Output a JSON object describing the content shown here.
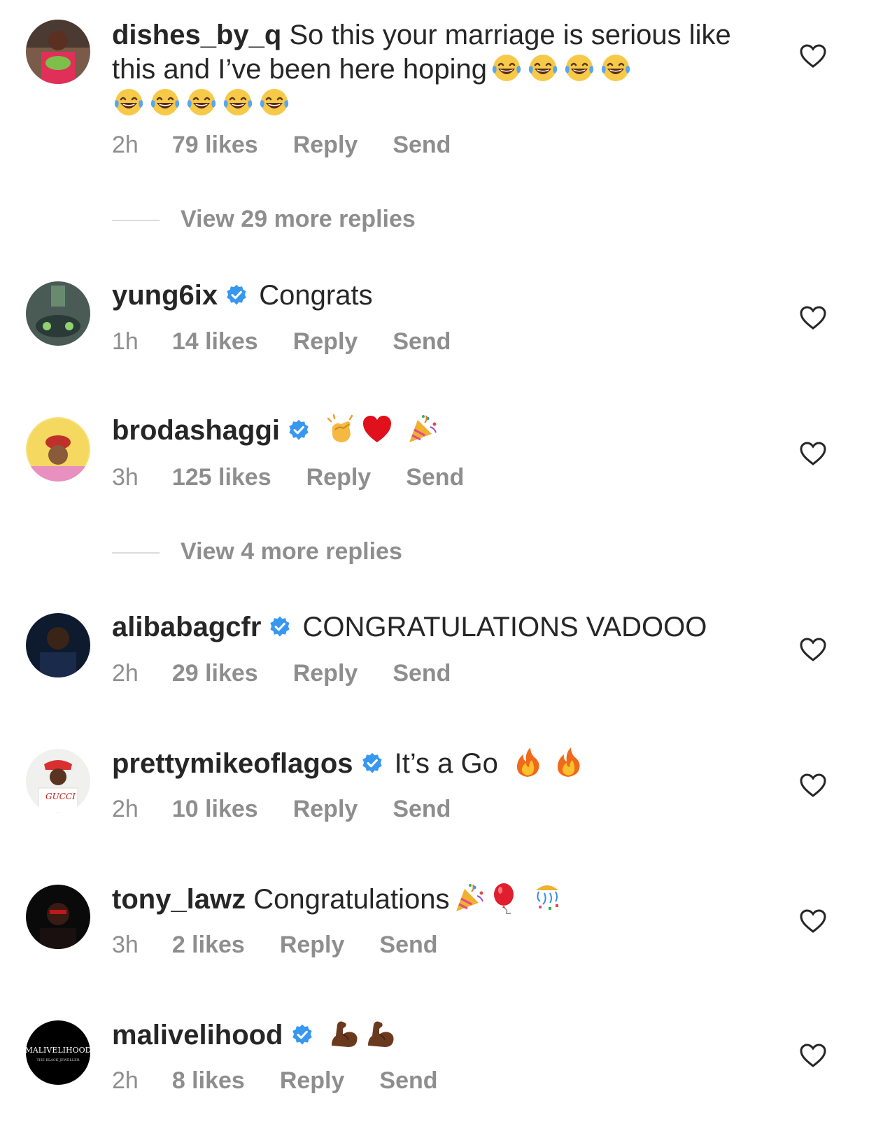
{
  "colors": {
    "text": "#262626",
    "muted": "#8e8e8e",
    "verified": "#3897f0",
    "divider": "#dbdbdb"
  },
  "comments": [
    {
      "username": "dishes_by_q",
      "verified": false,
      "text": "So this your marriage is serious like this and I’ve been here hoping",
      "emoji": [
        "face-with-tears-of-joy",
        "face-with-tears-of-joy",
        "face-with-tears-of-joy",
        "face-with-tears-of-joy",
        "face-with-tears-of-joy",
        "face-with-tears-of-joy",
        "face-with-tears-of-joy",
        "face-with-tears-of-joy",
        "face-with-tears-of-joy"
      ],
      "time": "2h",
      "likes": "79 likes",
      "reply": "Reply",
      "send": "Send"
    },
    {
      "username": "yung6ix",
      "verified": true,
      "text": "Congrats",
      "time": "1h",
      "likes": "14 likes",
      "reply": "Reply",
      "send": "Send"
    },
    {
      "username": "brodashaggi",
      "verified": true,
      "text": "",
      "emoji": [
        "clapping-hands",
        "red-heart",
        "party-popper"
      ],
      "time": "3h",
      "likes": "125 likes",
      "reply": "Reply",
      "send": "Send"
    },
    {
      "username": "alibabagcfr",
      "verified": true,
      "text": "CONGRATULATIONS VADOOO",
      "time": "2h",
      "likes": "29 likes",
      "reply": "Reply",
      "send": "Send"
    },
    {
      "username": "prettymikeoflagos",
      "verified": true,
      "text": "It’s a Go",
      "emoji": [
        "fire",
        "fire"
      ],
      "time": "2h",
      "likes": "10 likes",
      "reply": "Reply",
      "send": "Send"
    },
    {
      "username": "tony_lawz",
      "verified": false,
      "text": "Congratulations",
      "emoji": [
        "party-popper",
        "balloon",
        "confetti-ball"
      ],
      "time": "3h",
      "likes": "2 likes",
      "reply": "Reply",
      "send": "Send"
    },
    {
      "username": "malivelihood",
      "verified": true,
      "text": "",
      "emoji": [
        "flexed-biceps",
        "flexed-biceps"
      ],
      "time": "2h",
      "likes": "8 likes",
      "reply": "Reply",
      "send": "Send"
    }
  ],
  "view_more": [
    "View 29 more replies",
    "View 4 more replies"
  ],
  "avatar_text": {
    "malivelihood": "MALIVELIHOOD",
    "malivelihood_sub": "THE BLACK JEWELLER"
  }
}
